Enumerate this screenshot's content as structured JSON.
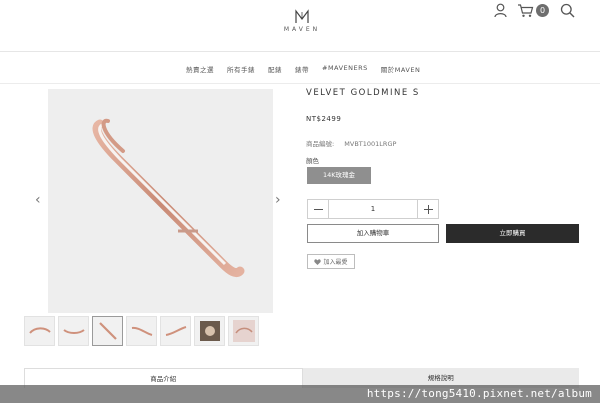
{
  "brand": {
    "name": "MAVEN"
  },
  "header": {
    "cart_count": "0",
    "icons": [
      "user-icon",
      "cart-icon",
      "search-icon"
    ]
  },
  "nav": {
    "items": [
      "熱賣之選",
      "所有手錶",
      "配錶",
      "錶帶",
      "#MAVENERS",
      "關於MAVEN"
    ]
  },
  "product": {
    "title": "VELVET GOLDMINE S",
    "price": "NT$2499",
    "sku_label": "商品編號:",
    "sku_value": "MVBT1001LRGP",
    "color_label": "顏色",
    "color_option": "14K玫瑰金",
    "quantity": "1",
    "add_to_cart": "加入購物車",
    "buy_now": "立即購買",
    "favorite": "加入最愛"
  },
  "gallery": {
    "arrow_left": "‹",
    "arrow_right": "›",
    "thumbnail_count": 7
  },
  "tabs": [
    "商品介紹",
    "規格說明"
  ],
  "watermark": "https://tong5410.pixnet.net/album",
  "colors": {
    "buy_button": "#2b2b2b",
    "color_chip": "#8f8f8f",
    "rose_gold": "#d9a08e"
  }
}
